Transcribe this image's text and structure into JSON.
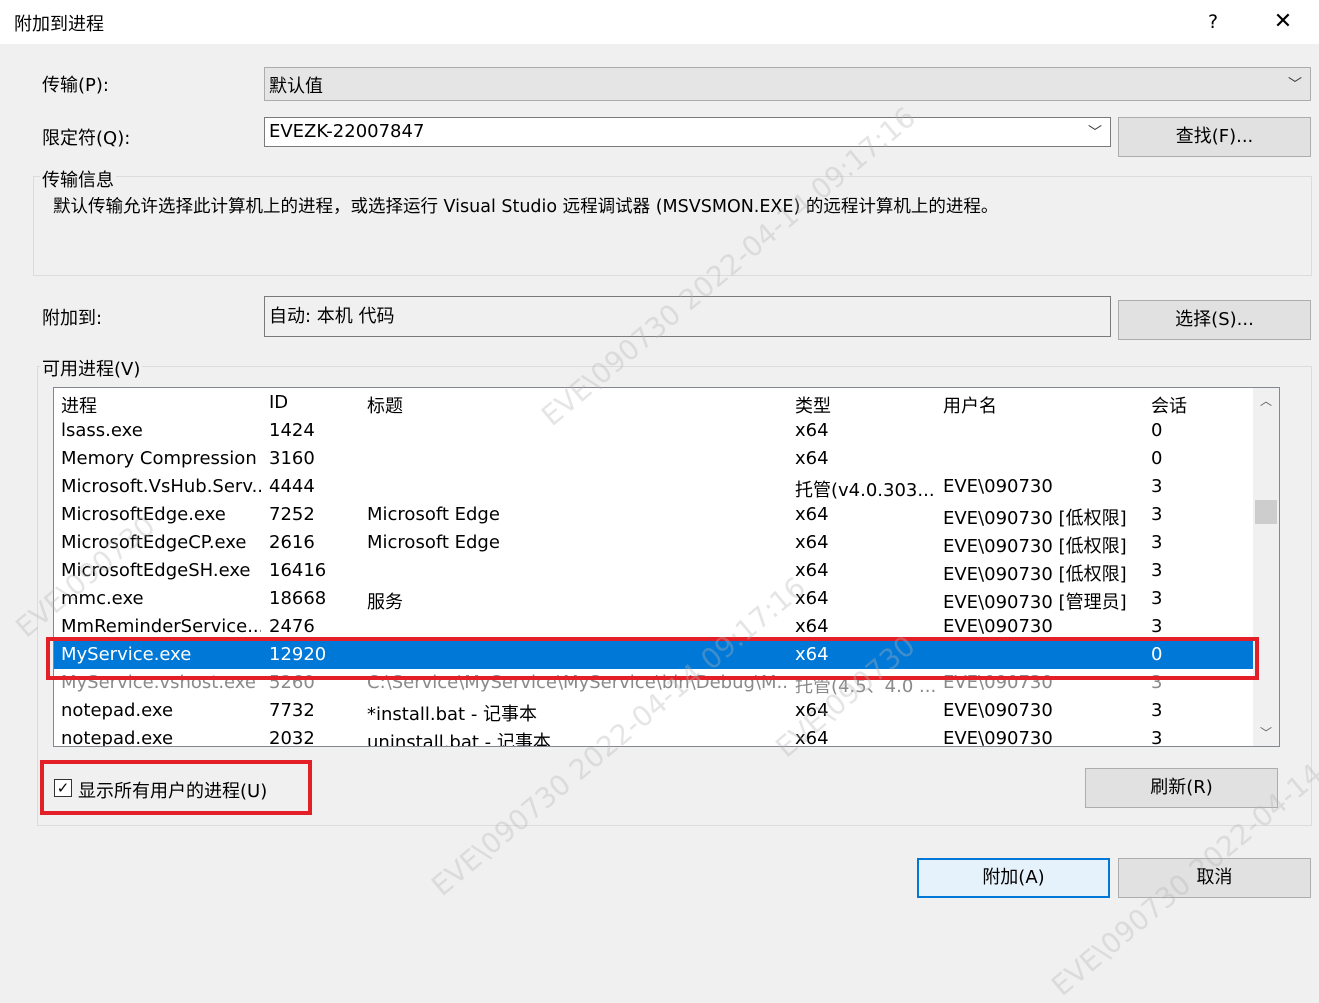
{
  "window": {
    "title": "附加到进程",
    "help_label": "?",
    "close_label": "✕"
  },
  "transport": {
    "label": "传输(P):",
    "value": "默认值"
  },
  "qualifier": {
    "label": "限定符(Q):",
    "value": "EVEZK-22007847",
    "find_button": "查找(F)..."
  },
  "transport_info": {
    "title": "传输信息",
    "text": "默认传输允许选择此计算机上的进程，或选择运行 Visual Studio 远程调试器 (MSVSMON.EXE) 的远程计算机上的进程。"
  },
  "attach_to": {
    "label": "附加到:",
    "value": "自动: 本机 代码",
    "select_button": "选择(S)..."
  },
  "processes": {
    "title": "可用进程(V)",
    "columns": [
      "进程",
      "ID",
      "标题",
      "类型",
      "用户名",
      "会话"
    ],
    "rows": [
      {
        "name": "lsass.exe",
        "id": "1424",
        "title": "",
        "type": "x64",
        "user": "",
        "session": "0"
      },
      {
        "name": "Memory Compression",
        "id": "3160",
        "title": "",
        "type": "x64",
        "user": "",
        "session": "0"
      },
      {
        "name": "Microsoft.VsHub.Serv...",
        "id": "4444",
        "title": "",
        "type": "托管(v4.0.303...",
        "user": "EVE\\090730",
        "session": "3"
      },
      {
        "name": "MicrosoftEdge.exe",
        "id": "7252",
        "title": "Microsoft Edge",
        "type": "x64",
        "user": "EVE\\090730 [低权限]",
        "session": "3"
      },
      {
        "name": "MicrosoftEdgeCP.exe",
        "id": "2616",
        "title": "Microsoft Edge",
        "type": "x64",
        "user": "EVE\\090730 [低权限]",
        "session": "3"
      },
      {
        "name": "MicrosoftEdgeSH.exe",
        "id": "16416",
        "title": "",
        "type": "x64",
        "user": "EVE\\090730 [低权限]",
        "session": "3"
      },
      {
        "name": "mmc.exe",
        "id": "18668",
        "title": "服务",
        "type": "x64",
        "user": "EVE\\090730 [管理员]",
        "session": "3"
      },
      {
        "name": "MmReminderService....",
        "id": "2476",
        "title": "",
        "type": "x64",
        "user": "EVE\\090730",
        "session": "3"
      },
      {
        "name": "MyService.exe",
        "id": "12920",
        "title": "",
        "type": "x64",
        "user": "",
        "session": "0"
      },
      {
        "name": "MyService.vshost.exe",
        "id": "5260",
        "title": "C:\\Service\\MyService\\MyService\\bin\\Debug\\M...",
        "type": "托管(4.5、4.0 ...",
        "user": "EVE\\090730",
        "session": "3"
      },
      {
        "name": "notepad.exe",
        "id": "7732",
        "title": "*install.bat - 记事本",
        "type": "x64",
        "user": "EVE\\090730",
        "session": "3"
      },
      {
        "name": "notepad.exe",
        "id": "2032",
        "title": "uninstall.bat - 记事本",
        "type": "x64",
        "user": "EVE\\090730",
        "session": "3"
      }
    ],
    "selected_index": 8,
    "show_all_users_label": "显示所有用户的进程(U)",
    "show_all_users_checked": true,
    "refresh_button": "刷新(R)"
  },
  "footer": {
    "attach_button": "附加(A)",
    "cancel_button": "取消"
  },
  "watermarks": [
    "EVE\\090730 2022-04-14 09:17:16",
    "EVE\\090730",
    "EVE\\090730 2022-04-14 09:17:16",
    "EVE\\090730",
    "EVE\\090730 2022-04-14 09:17:16"
  ],
  "colors": {
    "selection": "#0078d7",
    "highlight_box": "#e32027"
  }
}
